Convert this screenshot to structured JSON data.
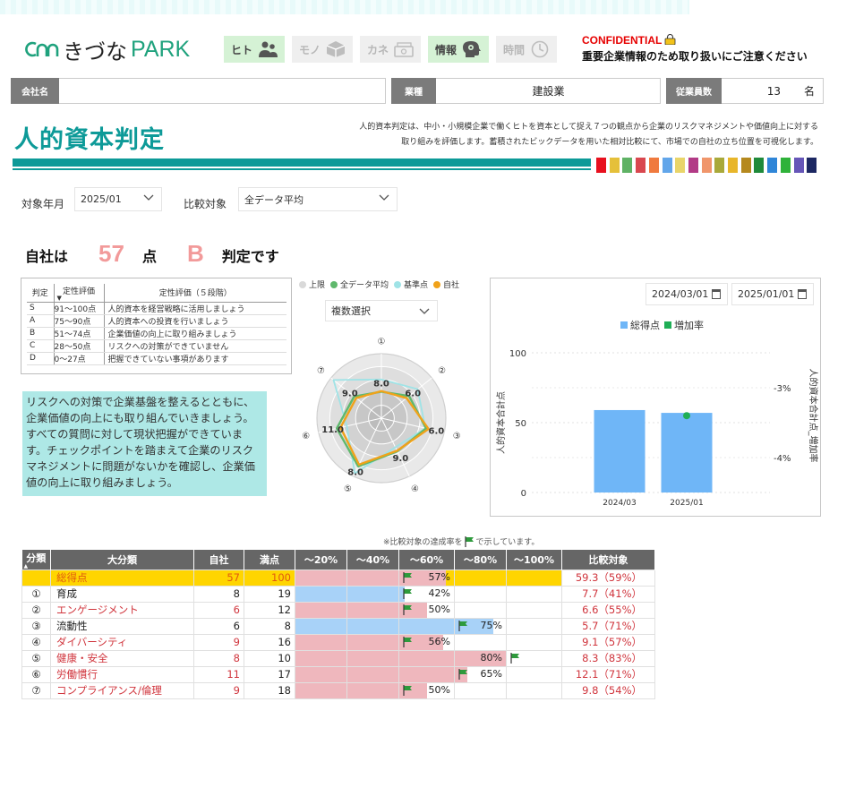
{
  "header": {
    "logo_ja": "きづな",
    "logo_en": "PARK",
    "nav": [
      {
        "label": "ヒト",
        "icon": "people-icon",
        "active": true
      },
      {
        "label": "モノ",
        "icon": "box-icon",
        "active": false
      },
      {
        "label": "カネ",
        "icon": "money-icon",
        "active": false
      },
      {
        "label": "情報",
        "icon": "brain-icon",
        "active": true
      },
      {
        "label": "時間",
        "icon": "clock-icon",
        "active": false
      }
    ],
    "confidential": "CONFIDENTIAL",
    "confidential_note": "重要企業情報のため取り扱いにご注意ください"
  },
  "info": {
    "company_label": "会社名",
    "company_value": "",
    "industry_label": "業種",
    "industry_value": "建設業",
    "employees_label": "従業員数",
    "employees_value": "13",
    "employees_unit": "名"
  },
  "page": {
    "title": "人的資本判定",
    "description_1": "人的資本判定は、中小・小規模企業で働くヒトを資本として捉え７つの観点から企業のリスクマネジメントや価値向上に対する",
    "description_2": "取り組みを評価します。蓄積されたビックデータを用いた相対比較にて、市場での自社の立ち位置を可視化します。",
    "swatches": [
      "#e8101e",
      "#e5c03a",
      "#5fb265",
      "#d9474f",
      "#f07a3e",
      "#62a6ea",
      "#e9d56a",
      "#b23a86",
      "#f0966b",
      "#a9a93a",
      "#e8b62a",
      "#b5891e",
      "#1f8a3a",
      "#2f86d8",
      "#2fb23a",
      "#6656b8",
      "#1c2762"
    ]
  },
  "filters": {
    "period_label": "対象年月",
    "period_value": "2025/01",
    "compare_label": "比較対象",
    "compare_value": "全データ平均"
  },
  "score": {
    "prefix": "自社は",
    "points": "57",
    "points_unit": "点",
    "grade": "B",
    "suffix": "判定です"
  },
  "grade_table": {
    "headers": [
      "判定",
      "定性評価",
      "定性評価（５段階）"
    ],
    "rows": [
      [
        "S",
        "91〜100点",
        "人的資本を経営戦略に活用しましょう"
      ],
      [
        "A",
        "75〜90点",
        "人的資本への投資を行いましょう"
      ],
      [
        "B",
        "51〜74点",
        "企業価値の向上に取り組みましょう"
      ],
      [
        "C",
        "28〜50点",
        "リスクへの対策ができていません"
      ],
      [
        "D",
        "0〜27点",
        "把握できていない事項があります"
      ]
    ]
  },
  "advice": "リスクへの対策で企業基盤を整えるとともに、企業価値の向上にも取り組んでいきましょう。すべての質問に対して現状把握ができています。チェックポイントを踏まえて企業のリスクマネジメントに問題がないかを確認し、企業価値の向上に取り組みましょう。",
  "radar_controls": {
    "legend": [
      {
        "name": "上限",
        "color": "#d9d9d9"
      },
      {
        "name": "全データ平均",
        "color": "#5fb86c"
      },
      {
        "name": "基準点",
        "color": "#9fe3e6"
      },
      {
        "name": "自社",
        "color": "#f0a21a"
      }
    ],
    "select_placeholder": "複数選択"
  },
  "bar_controls": {
    "date_from": "2024/03/01",
    "date_to": "2025/01/01"
  },
  "chart_data": [
    {
      "type": "radar",
      "axes": [
        "①",
        "②",
        "③",
        "④",
        "⑤",
        "⑥",
        "⑦"
      ],
      "legend": [
        "上限",
        "全データ平均",
        "基準点",
        "自社"
      ],
      "series": [
        {
          "name": "上限",
          "values": [
            1,
            1,
            1,
            1,
            1,
            1,
            1
          ]
        },
        {
          "name": "自社",
          "values": [
            0.42,
            0.5,
            0.75,
            0.56,
            0.8,
            0.65,
            0.5
          ],
          "labels": [
            "8.0",
            "6.0",
            "6.0",
            "9.0",
            "8.0",
            "11.0",
            "9.0"
          ]
        },
        {
          "name": "全データ平均",
          "values": [
            0.41,
            0.55,
            0.71,
            0.57,
            0.83,
            0.71,
            0.54
          ]
        },
        {
          "name": "基準点",
          "values": [
            0.6,
            0.72,
            0.7,
            0.5,
            0.95,
            0.55,
            0.95
          ]
        }
      ]
    },
    {
      "type": "bar",
      "categories": [
        "2024/03",
        "2025/01"
      ],
      "series": [
        {
          "name": "総得点",
          "values": [
            59,
            57
          ],
          "color": "#6fb6f7",
          "axis": "left"
        },
        {
          "name": "増加率",
          "values": [
            null,
            -3.4
          ],
          "color": "#1fae56",
          "axis": "right"
        }
      ],
      "ylabel": "人的資本合計点",
      "y2label": "人的資本合計点_増加率",
      "ylim": [
        0,
        100
      ],
      "yticks": [
        "0",
        "50",
        "100"
      ],
      "y2ticks": [
        "-3%",
        "-4%"
      ],
      "y2lim": [
        -4.5,
        -2.5
      ]
    }
  ],
  "detail": {
    "note": "※比較対象の達成率を",
    "note_after": "で示しています。",
    "headers": [
      "分類",
      "大分類",
      "自社",
      "満点",
      "〜20%",
      "〜40%",
      "〜60%",
      "〜80%",
      "〜100%",
      "比較対象"
    ],
    "rows": [
      {
        "idx": "",
        "name": "総得点",
        "own": "57",
        "max": "100",
        "pct": 57,
        "pct_label": "57%",
        "flag": 59,
        "cmp": "59.3（59%）",
        "fill": "pink",
        "total": true
      },
      {
        "idx": "①",
        "name": "育成",
        "own": "8",
        "max": "19",
        "pct": 42,
        "pct_label": "42%",
        "flag": 41,
        "cmp": "7.7（41%）",
        "fill": "blue"
      },
      {
        "idx": "②",
        "name": "エンゲージメント",
        "own": "6",
        "max": "12",
        "pct": 50,
        "pct_label": "50%",
        "flag": 55,
        "cmp": "6.6（55%）",
        "fill": "pink"
      },
      {
        "idx": "③",
        "name": "流動性",
        "own": "6",
        "max": "8",
        "pct": 75,
        "pct_label": "75%",
        "flag": 71,
        "cmp": "5.7（71%）",
        "fill": "blue"
      },
      {
        "idx": "④",
        "name": "ダイバーシティ",
        "own": "9",
        "max": "16",
        "pct": 56,
        "pct_label": "56%",
        "flag": 57,
        "cmp": "9.1（57%）",
        "fill": "pink"
      },
      {
        "idx": "⑤",
        "name": "健康・安全",
        "own": "8",
        "max": "10",
        "pct": 80,
        "pct_label": "80%",
        "flag": 83,
        "cmp": "8.3（83%）",
        "fill": "pink"
      },
      {
        "idx": "⑥",
        "name": "労働慣行",
        "own": "11",
        "max": "17",
        "pct": 65,
        "pct_label": "65%",
        "flag": 71,
        "cmp": "12.1（71%）",
        "fill": "pink"
      },
      {
        "idx": "⑦",
        "name": "コンプライアンス/倫理",
        "own": "9",
        "max": "18",
        "pct": 50,
        "pct_label": "50%",
        "flag": 54,
        "cmp": "9.8（54%）",
        "fill": "pink"
      }
    ]
  }
}
